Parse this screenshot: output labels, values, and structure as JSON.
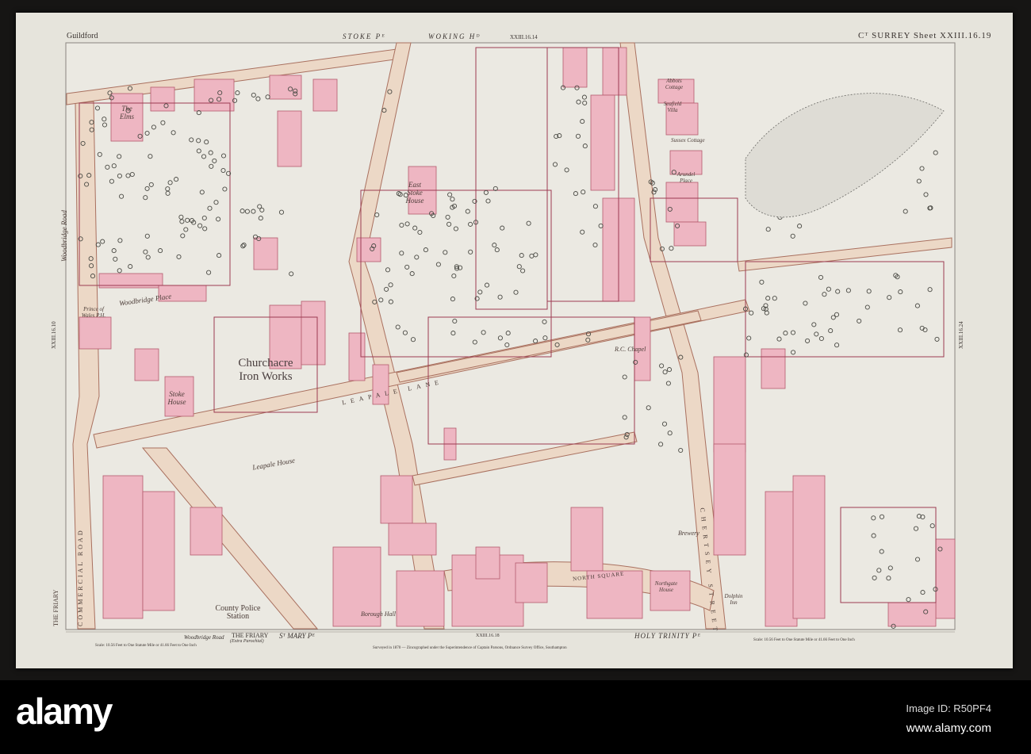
{
  "sheet": {
    "place": "Guildford",
    "parish_top_left": "STOKE Pᴱ",
    "parish_top_right": "WOKING Hᴰ",
    "adjoining_top": "XXIII.16.14",
    "adjoining_left": "XXIII.16.10",
    "adjoining_right": "XXIII.16.24",
    "adjoining_bottom": "XXIII.16.18",
    "county_sheet": "Cᵀ SURREY  Sheet XXIII.16.19"
  },
  "labels": {
    "the_elms": "The Elms",
    "east_stoke_house": "East Stoke House",
    "woodbridge_road": "Woodbridge Road",
    "woodbridge_place": "Woodbridge Place",
    "prince_of_wales": "Prince of Wales P.H.",
    "churchacre_iron_works": "Churchacre Iron Works",
    "stoke_house": "Stoke House",
    "leapale_house": "Leapale House",
    "leapale_lane": "LEAPALE LANE",
    "rc_chapel": "R.C. Chapel",
    "county_police_station": "County Police Station",
    "borough_hall": "Borough Hall",
    "north_square": "NORTH SQUARE",
    "northgate_house": "Northgate House",
    "dolphin_inn": "Dolphin Inn",
    "brewery": "Brewery",
    "commercial_road": "COMMERCIAL ROAD",
    "the_friary": "THE FRIARY",
    "seafield_villa": "Seafield Villa",
    "abbots_cottage": "Abbots Cottage",
    "sussex_cottage": "Sussex Cottage",
    "arundel_place": "Arundel Place",
    "chertsey_street": "CHERTSEY STREET"
  },
  "bottom_margin": {
    "woodbridge_road": "Woodbridge Road",
    "the_friary": "THE FRIARY",
    "the_friary_note": "(Extra Parochial)",
    "st_mary": "Sᵀ MARY Pᴱ",
    "holy_trinity": "HOLY TRINITY Pᴱ",
    "scale_left": "Scale: 10.56 Feet to One Statute Mile or 41.66 Feet to One Inch",
    "scale_right": "Scale: 10.56 Feet to One Statute Mile or 41.66 Feet to One Inch",
    "survey_note": "Surveyed in 1870 — Zincographed under the Superintendence of Captain Parsons, Ordnance Survey Office, Southampton"
  },
  "colors": {
    "paper": "#e6e4dc",
    "building": "#eeb6c2",
    "road": "#ecd8c6",
    "boundary": "#a23c52"
  },
  "footer": {
    "logo": "alamy",
    "image_id": "Image ID: R50PF4",
    "url": "www.alamy.com"
  }
}
